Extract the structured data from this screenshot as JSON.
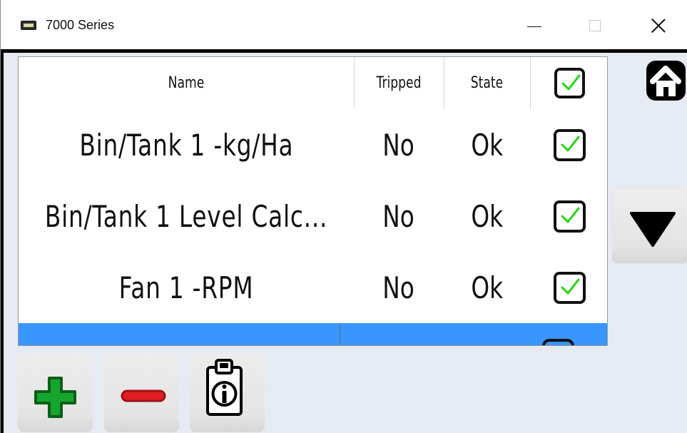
{
  "window": {
    "title": "7000 Series",
    "icon": "device-icon",
    "controls": {
      "minimize": "minimize-icon",
      "maximize": "maximize-icon",
      "close": "close-icon"
    }
  },
  "table": {
    "columns": {
      "name": "Name",
      "tripped": "Tripped",
      "state": "State"
    },
    "rows": [
      {
        "name": "Bin/Tank 1 -kg/Ha",
        "tripped": "No",
        "state": "Ok",
        "checked": true
      },
      {
        "name": "Bin/Tank 1 Level Calc...",
        "tripped": "No",
        "state": "Ok",
        "checked": true
      },
      {
        "name": "Fan 1 -RPM",
        "tripped": "No",
        "state": "Ok",
        "checked": true
      }
    ],
    "selected_row_color": "#3996ff"
  },
  "actions": {
    "home": "home-icon",
    "scroll_down": "triangle-down-icon",
    "add": "plus-icon",
    "remove": "minus-icon",
    "info": "clipboard-info-icon"
  },
  "colors": {
    "content_background": "#e6ebf3",
    "check_green": "#16d600",
    "add_green": "#16a52d",
    "remove_red": "#e01f25",
    "selected_blue": "#3996ff"
  }
}
